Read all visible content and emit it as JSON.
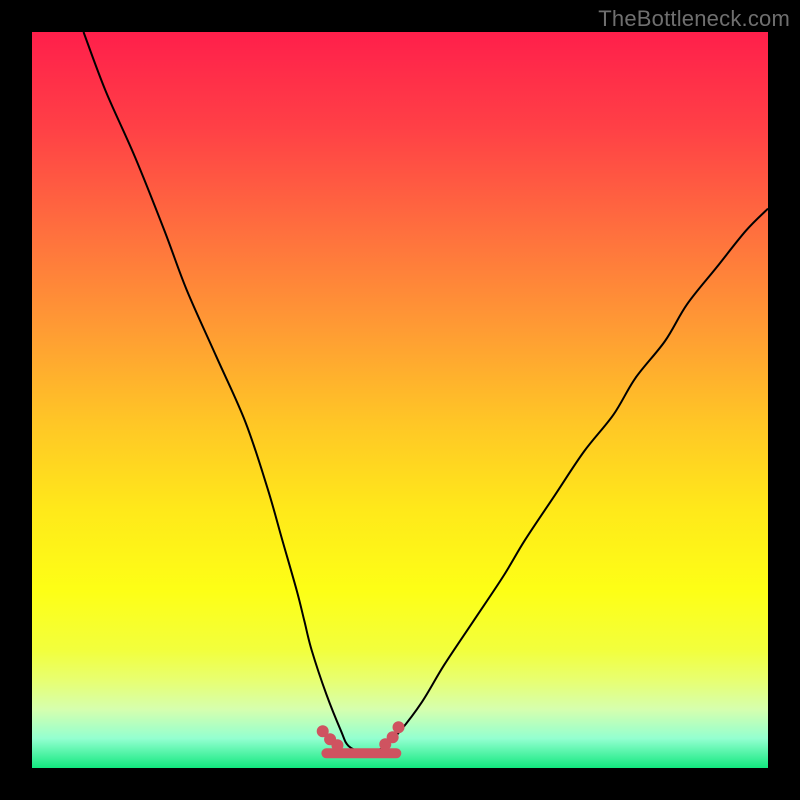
{
  "watermark": "TheBottleneck.com",
  "chart_data": {
    "type": "line",
    "title": "",
    "xlabel": "",
    "ylabel": "",
    "xlim": [
      0,
      100
    ],
    "ylim": [
      0,
      100
    ],
    "grid": false,
    "legend": false,
    "series": [
      {
        "name": "curve",
        "x": [
          7,
          10,
          14,
          18,
          21,
          25,
          29,
          32,
          34,
          36,
          37,
          38,
          40,
          42,
          43,
          45,
          46,
          48,
          50,
          53,
          56,
          60,
          64,
          67,
          71,
          75,
          79,
          82,
          86,
          89,
          93,
          97,
          100
        ],
        "y": [
          100,
          92,
          83,
          73,
          65,
          56,
          47,
          38,
          31,
          24,
          20,
          16,
          10,
          5,
          3,
          2,
          2,
          3,
          5,
          9,
          14,
          20,
          26,
          31,
          37,
          43,
          48,
          53,
          58,
          63,
          68,
          73,
          76
        ],
        "color": "#000000"
      }
    ],
    "flat_segment": {
      "x_range": [
        40,
        49.5
      ],
      "y": 2,
      "color": "#cf5360",
      "dot_x": [
        39.5,
        40.5,
        41.5,
        48,
        49,
        49.8
      ]
    },
    "background_gradient_stops": [
      {
        "pct": 0,
        "color": "#ff1f4b"
      },
      {
        "pct": 13,
        "color": "#ff4046"
      },
      {
        "pct": 27,
        "color": "#ff6f3e"
      },
      {
        "pct": 40,
        "color": "#ff9a34"
      },
      {
        "pct": 53,
        "color": "#ffc626"
      },
      {
        "pct": 65,
        "color": "#ffe91a"
      },
      {
        "pct": 76,
        "color": "#fdff16"
      },
      {
        "pct": 84,
        "color": "#f2ff3d"
      },
      {
        "pct": 88,
        "color": "#e8ff70"
      },
      {
        "pct": 92,
        "color": "#d6ffae"
      },
      {
        "pct": 96,
        "color": "#93ffd0"
      },
      {
        "pct": 100,
        "color": "#12e87e"
      }
    ]
  }
}
